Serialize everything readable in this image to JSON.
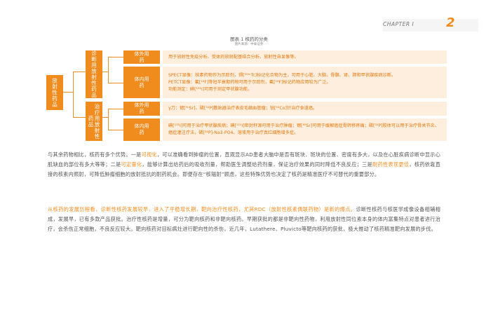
{
  "header": {
    "chapter": "CHAPTER I",
    "page_number": "2"
  },
  "figure": {
    "title": "图表 1 核药的分类",
    "source": "图片来源：中泰证券",
    "root": "放射性药品",
    "categories": [
      {
        "label": "诊断用放射性药品",
        "rows": [
          {
            "label": "体外用药",
            "desc": "用于放射性免疫分析、受体的放射配基结合分析、放射性自显像等。"
          },
          {
            "label": "体内用药",
            "desc": "SPECT显像：核素药物作为示踪剂，锝[⁹⁹ᵐTc]标记化合物为主，可用于心脏、大脑、骨骼、肾、肺和甲状腺疾病诊断。\nPETCT显像：氟[¹⁸F]等短半衰期药物可用于示踪剂，氟[¹⁸F]标记药物应用较为广泛。\n功能测定：碘[¹³¹I]可用于测定甲状腺功能。"
          }
        ]
      },
      {
        "label": "治疗用放射性药品",
        "rows": [
          {
            "label": "体外用药",
            "desc": "γ刀：锶[⁹⁰Sr]、磷[³²P]敷贴器治疗表皮毛细血管瘤；钴[⁶⁰Co]针治疗食道癌。"
          },
          {
            "label": "体内用药",
            "desc": "碘[¹³¹I]可用于治疗甲状腺疾病；碘[¹²⁵I]密封籽源可用于治疗肿瘤；锶[⁸⁹Sr]可用于缓解癌症骨转移疼痛；磷[³²P]胶体可以用于治疗骨关节炎、癌症灌注疗法，磷[³²P]-Na3-PO4、溶液用于治疗真红细胞增多症。"
          }
        ]
      }
    ]
  },
  "paragraph1": {
    "p1": "与其余药物相比，核药有多个优势。一是",
    "h1": "可视化",
    "p2": "，可以准确看到肿瘤的位置，直观显示AD患者大脑中是否有斑块、斑块的位置、密度有多大，以及在心脏疾病诊断中显示心肌缺血的部位有多大等等；二是",
    "h2": "可定量化",
    "p3": "，能够计算出给药后的吸收剂量，帮助医生调整给药剂量，保证治疗效果的同时降低不良反应；三是",
    "h3": "耐药性表现更佳",
    "p4": "，核药依靠直接的核素内照射，可降低肿瘤细胞的放射抵抗的耐药机会。即便存在“核辐射”顾虑，这些特殊优势也决定了核药是精准医疗不可替代的重要部分。"
  },
  "paragraph2": {
    "h1": "从核药的发展历程看，诊断性核药发展较早，进入了平稳增长期，靶向治疗性核药，尤其RDC（放射性核素偶联药物）是新的爆点。",
    "p1": "诊断性核药与核医学成像设备相辅相成，发展早，已有多款产品获批。治疗性核药是增量，可分为靶向核药和非靶向核药。早期获批的都是非靶向性药物，利用放射性同位素本身的体内富集特点对患者进行治疗，会杀伤正常细胞，不良反应较大。靶向核药对目标病灶进行靶向性的杀伤，近几年，Lutathere、Pluvicto等靶向核药的获批，极大推动了核药精准靶向发展的步伐。"
  }
}
